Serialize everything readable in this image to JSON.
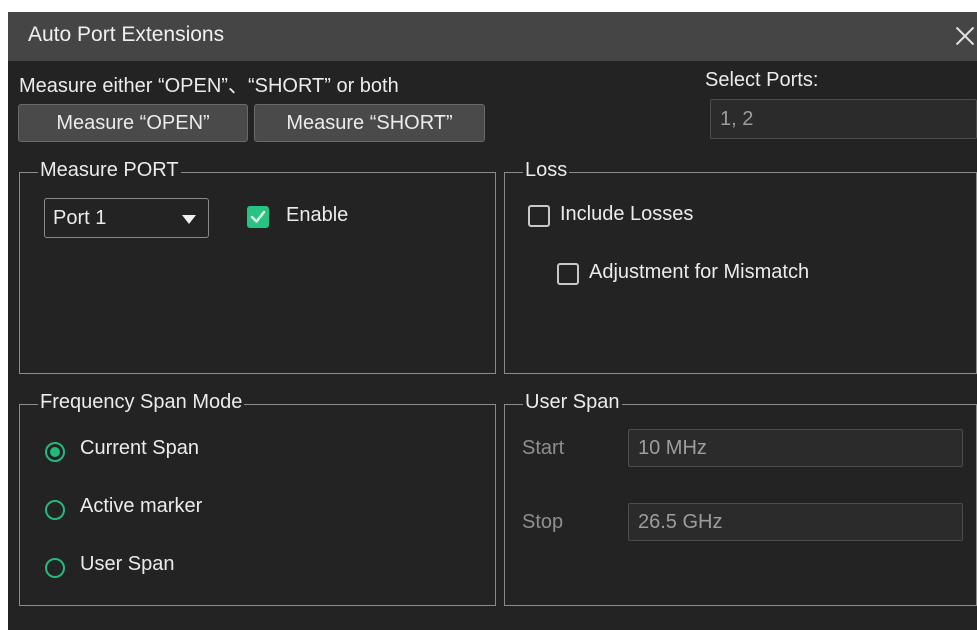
{
  "window": {
    "title": "Auto Port Extensions"
  },
  "measure": {
    "instruction": "Measure either “OPEN”、“SHORT” or both",
    "open_button": "Measure “OPEN”",
    "short_button": "Measure “SHORT”"
  },
  "select_ports": {
    "label": "Select Ports:",
    "value": "1, 2"
  },
  "measure_port": {
    "title": "Measure PORT",
    "port_select": "Port 1",
    "enable_label": "Enable",
    "enable_checked": true
  },
  "loss": {
    "title": "Loss",
    "include_losses": "Include Losses",
    "include_losses_checked": false,
    "adjustment": "Adjustment for Mismatch",
    "adjustment_checked": false
  },
  "frequency_span_mode": {
    "title": "Frequency Span Mode",
    "options": [
      {
        "label": "Current Span",
        "selected": true
      },
      {
        "label": "Active marker",
        "selected": false
      },
      {
        "label": "User Span",
        "selected": false
      }
    ]
  },
  "user_span": {
    "title": "User Span",
    "start_label": "Start",
    "start_value": "10 MHz",
    "stop_label": "Stop",
    "stop_value": "26.5 GHz"
  },
  "colors": {
    "accent": "#25b87b",
    "background": "#232323",
    "titlebar": "#454545"
  },
  "icons": {
    "close": "close-icon",
    "dropdown": "chevron-down-icon",
    "check": "check-icon"
  }
}
